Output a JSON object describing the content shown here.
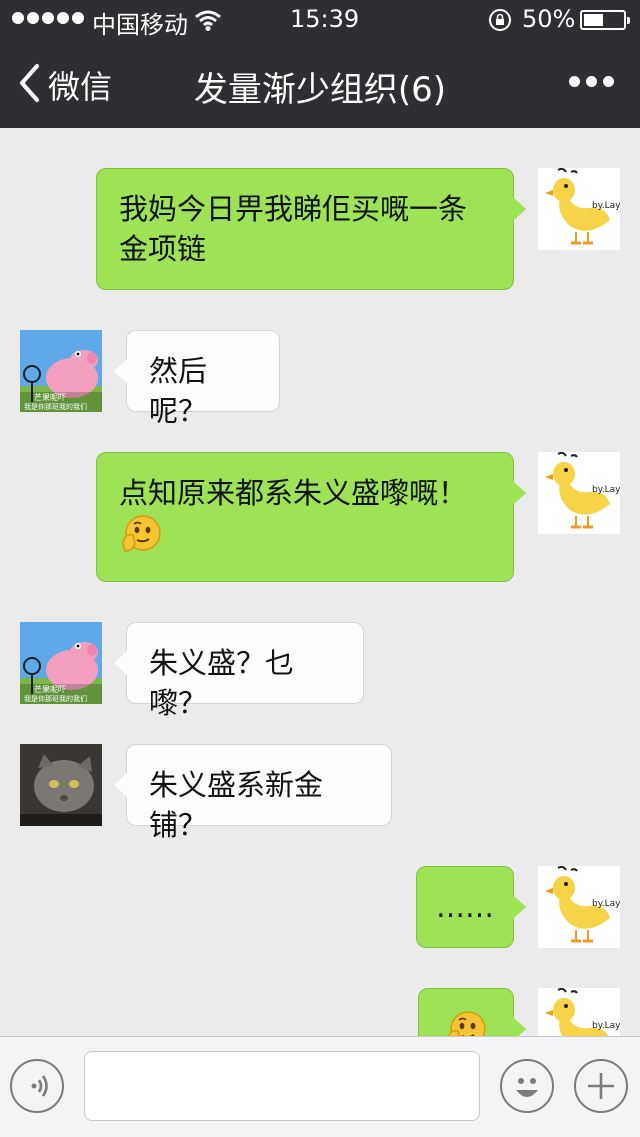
{
  "status_bar": {
    "carrier": "中国移动",
    "time": "15:39",
    "battery": "50%",
    "battery_level": 0.5
  },
  "nav": {
    "back_label": "微信",
    "title": "发量渐少组织(6)"
  },
  "messages": [
    {
      "side": "right",
      "sender": "duck",
      "text": "我妈今日畀我睇佢买嘅一条金项链"
    },
    {
      "side": "left",
      "sender": "peppa",
      "text": "然后呢？"
    },
    {
      "side": "right",
      "sender": "duck",
      "text": "点知原来都系朱义盛嚟嘅！",
      "emoji": "thinking-face"
    },
    {
      "side": "left",
      "sender": "peppa",
      "text": "朱义盛？乜嚟？"
    },
    {
      "side": "left",
      "sender": "cat",
      "text": "朱义盛系新金铺？"
    },
    {
      "side": "right",
      "sender": "duck",
      "text": "……"
    },
    {
      "side": "right",
      "sender": "duck",
      "text": "",
      "emoji": "thinking-face"
    }
  ],
  "avatars": {
    "duck_caption": "by.Layla",
    "peppa_caption_1": "芒果呢吓",
    "peppa_caption_2": "我是你那班我的我们"
  },
  "input_bar": {
    "placeholder": "",
    "icons": [
      "voice-icon",
      "emoji-icon",
      "plus-icon"
    ]
  },
  "colors": {
    "nav_bg": "#2f2f33",
    "chat_bg": "#ebebeb",
    "bubble_right": "#9de355",
    "bubble_left": "#fdfdfd"
  }
}
